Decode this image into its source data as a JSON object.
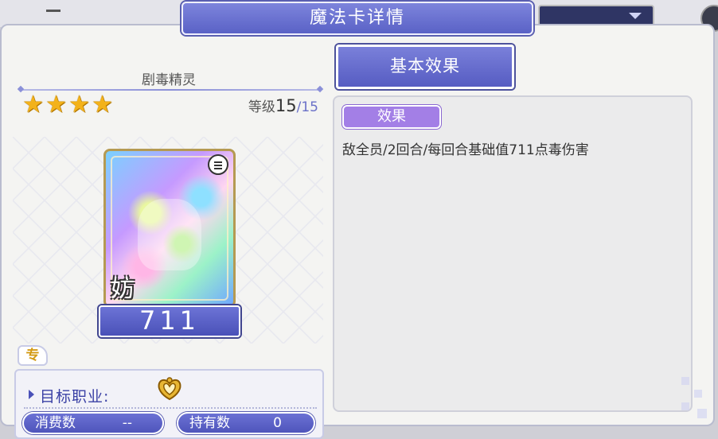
{
  "dialog": {
    "title": "魔法卡详情"
  },
  "card": {
    "name": "剧毒精灵",
    "stars": 4,
    "level_label": "等级",
    "level_current": "15",
    "level_separator": "/",
    "level_max": "15",
    "corner_char": "妨",
    "power": "711",
    "exclusive_badge": "专"
  },
  "target": {
    "label": "目标职业:",
    "consume_label": "消费数",
    "consume_value": "--",
    "hold_label": "持有数",
    "hold_value": "0"
  },
  "effects": {
    "tab_label": "基本效果",
    "tag_label": "效果",
    "description": "敌全员/2回合/每回合基础值711点毒伤害"
  },
  "colors": {
    "accent": "#5a62c6",
    "effect_tag": "#a37fe6",
    "star": "#f3b21a"
  }
}
